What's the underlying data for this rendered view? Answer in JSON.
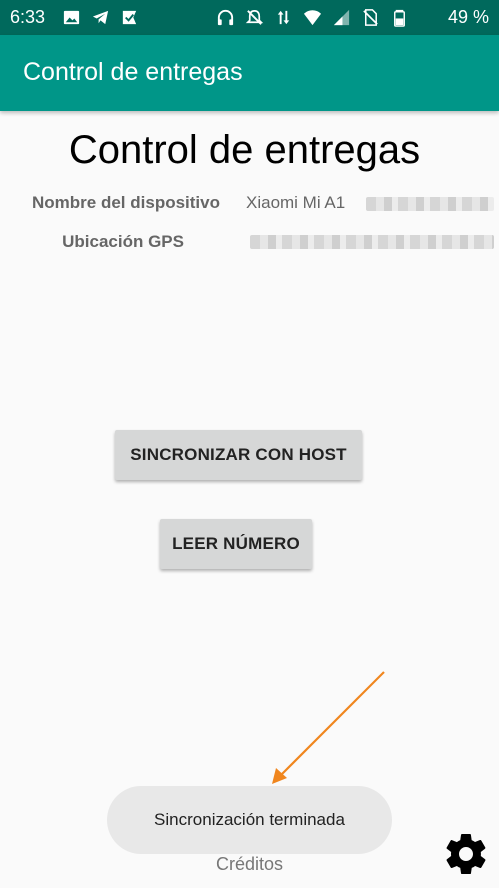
{
  "status_bar": {
    "time": "6:33",
    "battery": "49 %",
    "left_icons": [
      "image-icon",
      "telegram-icon",
      "check-badge-icon"
    ],
    "right_icons": [
      "headphones-icon",
      "notifications-off-icon",
      "data-arrows-icon",
      "wifi-icon",
      "signal-icon",
      "sim-off-icon",
      "battery-icon"
    ]
  },
  "app_bar": {
    "title": "Control de entregas",
    "color": "#009688"
  },
  "main": {
    "title": "Control de entregas",
    "device_label": "Nombre del dispositivo",
    "device_value": "Xiaomi Mi A1",
    "gps_label": "Ubicación GPS"
  },
  "buttons": {
    "sync": "SINCRONIZAR CON HOST",
    "read_number": "LEER NÚMERO"
  },
  "toast": {
    "message": "Sincronización terminada"
  },
  "footer": {
    "credits": "Créditos",
    "settings_icon": "gear-icon"
  },
  "annotation": {
    "arrow_color": "#f0861e"
  }
}
